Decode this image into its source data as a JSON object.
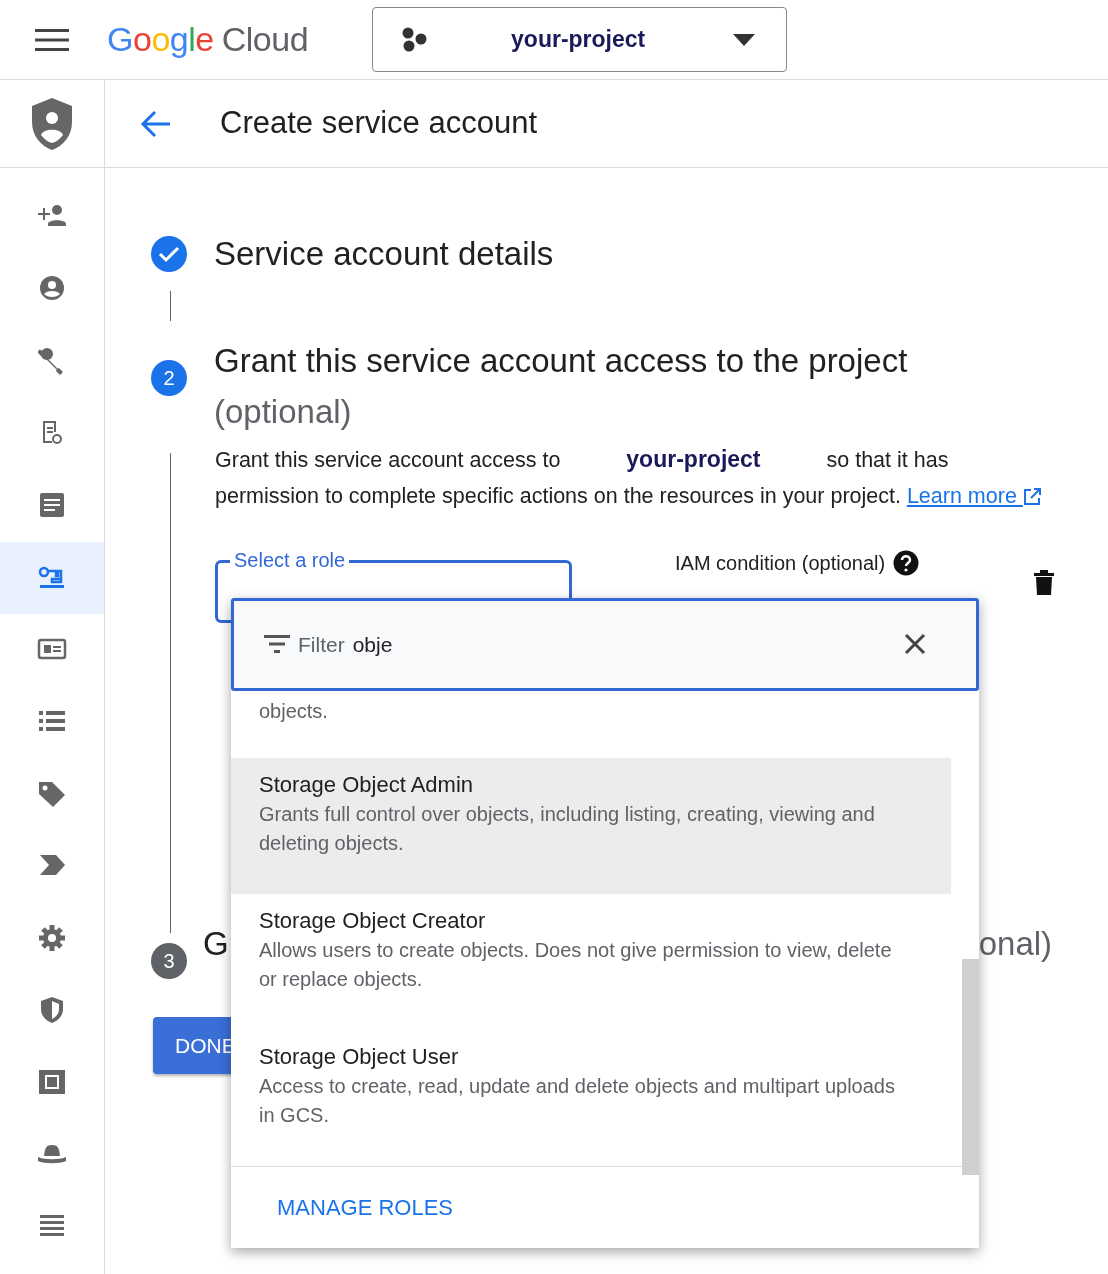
{
  "top_bar": {
    "logo_google": "Google",
    "logo_cloud": "Cloud",
    "project": "your-project"
  },
  "sidebar": {
    "items": [
      {
        "kind": "adduser",
        "selected": false
      },
      {
        "kind": "account",
        "selected": false
      },
      {
        "kind": "wrench",
        "selected": false
      },
      {
        "kind": "audit",
        "selected": false
      },
      {
        "kind": "article",
        "selected": false
      },
      {
        "kind": "key",
        "selected": true
      },
      {
        "kind": "card",
        "selected": false
      },
      {
        "kind": "list",
        "selected": false
      },
      {
        "kind": "tag",
        "selected": false
      },
      {
        "kind": "chevron",
        "selected": false
      },
      {
        "kind": "gear",
        "selected": false
      },
      {
        "kind": "shield",
        "selected": false
      },
      {
        "kind": "film",
        "selected": false
      },
      {
        "kind": "hat",
        "selected": false
      },
      {
        "kind": "lines",
        "selected": false
      }
    ]
  },
  "header": {
    "title": "Create service account"
  },
  "steps": [
    {
      "kind": "done",
      "title": "Service account details"
    },
    {
      "kind": "active",
      "marker": "2",
      "title": "Grant this service account access to the project",
      "suffix": "(optional)"
    },
    {
      "kind": "pending",
      "marker": "3",
      "title": "G",
      "suffix": "onal)"
    }
  ],
  "grant": {
    "text": "Grant this service account access to **your-project** so that it has permission to complete specific actions on the resources in your project.",
    "link": "Learn more"
  },
  "role_field": {
    "label": "Select a role"
  },
  "condition": {
    "label": "IAM condition (optional)"
  },
  "done_button": "DONE",
  "dropdown": {
    "filter_label": "Filter",
    "filter_value": "obje",
    "items": [
      {
        "description": "objects.",
        "highlighted": false
      },
      {
        "title": "Storage Object Admin",
        "description": "Grants full control over objects, including listing, creating, viewing and deleting objects.",
        "highlighted": true
      },
      {
        "title": "Storage Object Creator",
        "description": "Allows users to create objects. Does not give permission to view, delete or replace objects.",
        "highlighted": false
      },
      {
        "title": "Storage Object User",
        "description": "Access to create, read, update and delete objects and multipart uploads in GCS.",
        "highlighted": false
      }
    ],
    "footer": "MANAGE ROLES"
  }
}
